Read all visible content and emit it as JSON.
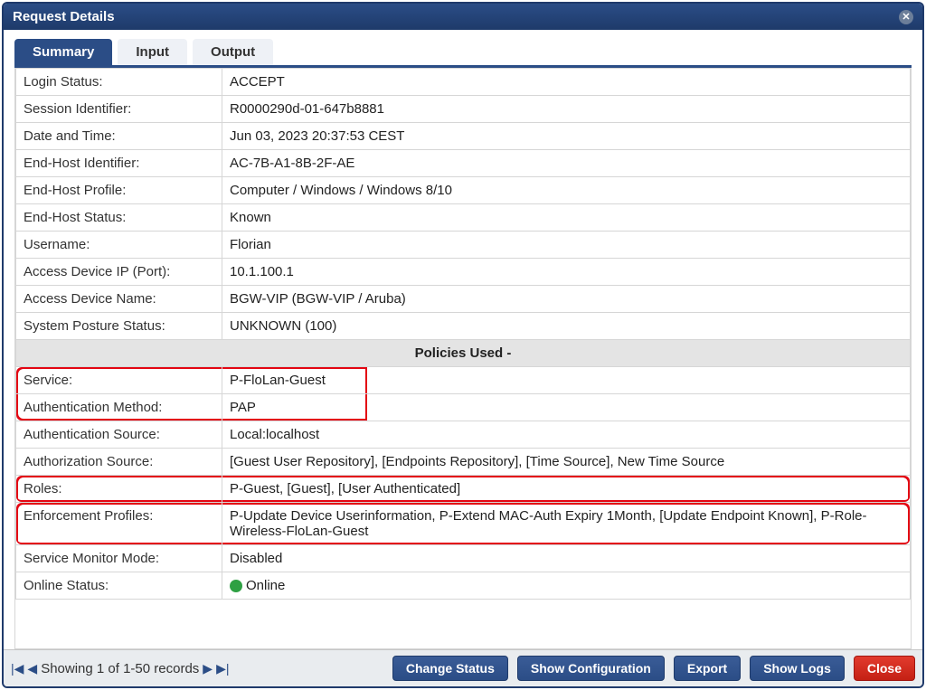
{
  "window": {
    "title": "Request Details"
  },
  "tabs": {
    "summary": "Summary",
    "input": "Input",
    "output": "Output"
  },
  "summary": {
    "rows": [
      {
        "label": "Login Status:",
        "value": "ACCEPT"
      },
      {
        "label": "Session Identifier:",
        "value": "R0000290d-01-647b8881"
      },
      {
        "label": "Date and Time:",
        "value": "Jun 03, 2023 20:37:53 CEST"
      },
      {
        "label": "End-Host Identifier:",
        "value": "AC-7B-A1-8B-2F-AE",
        "link": true
      },
      {
        "label": "End-Host Profile:",
        "value": "Computer / Windows / Windows 8/10"
      },
      {
        "label": "End-Host Status:",
        "value": "Known"
      },
      {
        "label": "Username:",
        "value": "Florian"
      },
      {
        "label": "Access Device IP (Port):",
        "value": "10.1.100.1"
      },
      {
        "label": "Access Device Name:",
        "value": "BGW-VIP (BGW-VIP / Aruba)"
      },
      {
        "label": "System Posture Status:",
        "value": "UNKNOWN (100)"
      }
    ],
    "policies_header": "Policies Used -",
    "policies": [
      {
        "label": "Service:",
        "value": "P-FloLan-Guest",
        "hl": "top"
      },
      {
        "label": "Authentication Method:",
        "value": "PAP",
        "hl": "bottom"
      },
      {
        "label": "Authentication Source:",
        "value": "Local:localhost"
      },
      {
        "label": "Authorization Source:",
        "value": "[Guest User Repository], [Endpoints Repository], [Time Source], New Time Source"
      },
      {
        "label": "Roles:",
        "value": "P-Guest, [Guest], [User Authenticated]",
        "hl": "single"
      },
      {
        "label": "Enforcement Profiles:",
        "value": "P-Update Device Userinformation, P-Extend MAC-Auth Expiry 1Month, [Update Endpoint Known], P-Role-Wireless-FloLan-Guest",
        "hl": "single"
      },
      {
        "label": "Service Monitor Mode:",
        "value": "Disabled"
      },
      {
        "label": "Online Status:",
        "value": "Online",
        "status": true
      }
    ]
  },
  "footer": {
    "pager_text": "Showing 1 of 1-50 records",
    "buttons": {
      "change_status": "Change Status",
      "show_config": "Show Configuration",
      "export": "Export",
      "show_logs": "Show Logs",
      "close": "Close"
    }
  }
}
